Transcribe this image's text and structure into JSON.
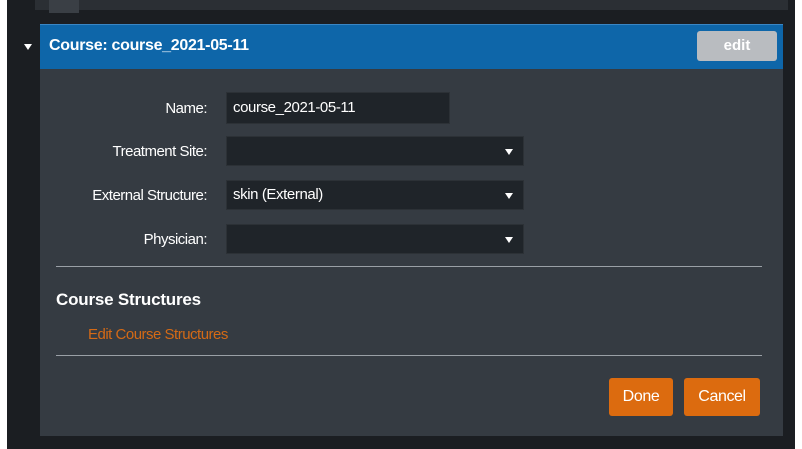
{
  "course_panel": {
    "title": "Course: course_2021-05-11",
    "edit_label": "edit",
    "name_label": "Name:",
    "name_value": "course_2021-05-11",
    "treatment_site_label": "Treatment Site:",
    "treatment_site_value": "",
    "external_structure_label": "External Structure:",
    "external_structure_value": "skin (External)",
    "physician_label": "Physician:",
    "physician_value": "",
    "structures_title": "Course Structures",
    "edit_structures_link": "Edit Course Structures",
    "done_label": "Done",
    "cancel_label": "Cancel"
  },
  "colors": {
    "header_blue": "#0e66a9",
    "panel_bg": "#353b42",
    "accent_orange": "#dc6b0f",
    "link_orange": "#d46a16"
  },
  "icons": {
    "collapse": "caret-down-icon",
    "select": "caret-down-icon"
  }
}
